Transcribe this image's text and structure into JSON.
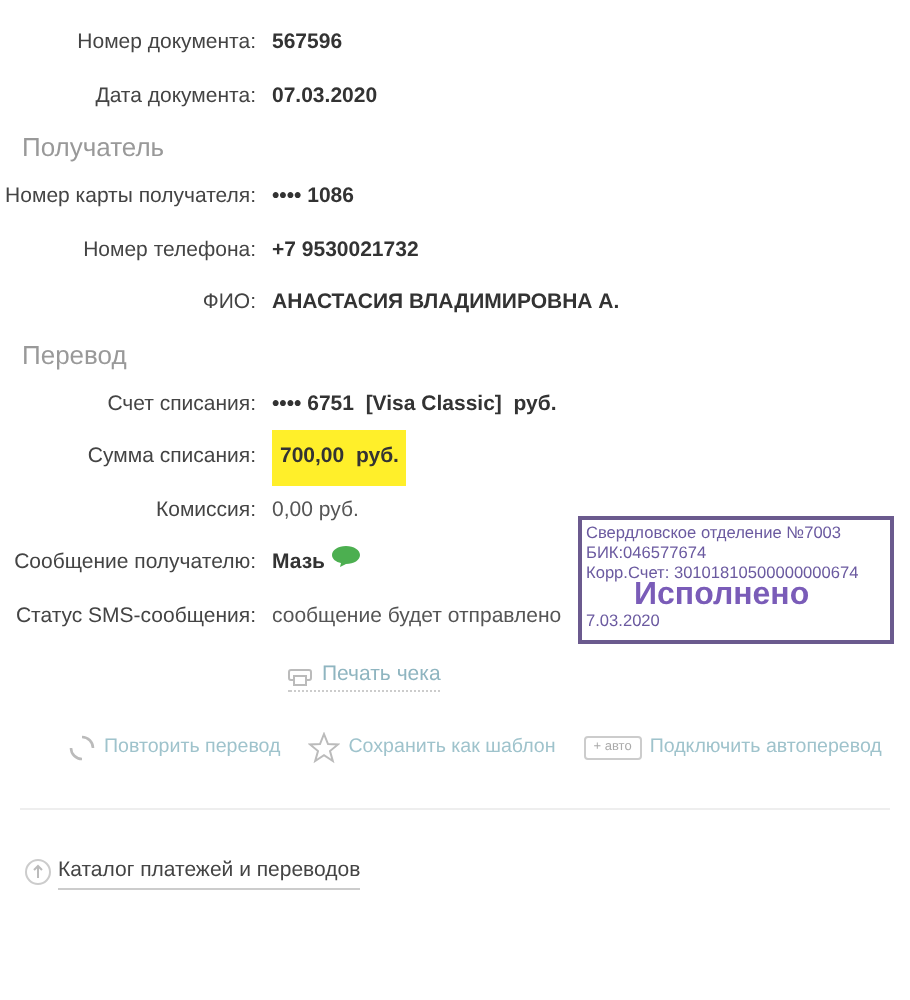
{
  "document": [
    {
      "label": "Номер документа:",
      "value": "567596",
      "kind": "bold"
    },
    {
      "label": "Дата документа:",
      "value": "07.03.2020",
      "kind": "bold"
    }
  ],
  "sections": [
    {
      "title": "Получатель",
      "rows": [
        {
          "label": "Номер карты получателя:",
          "value": "•••• 1086",
          "kind": "bold"
        },
        {
          "label": "Номер телефона:",
          "value": "+7 9530021732",
          "kind": "bold"
        },
        {
          "label": "ФИО:",
          "value": "АНАСТАСИЯ ВЛАДИМИРОВНА А.",
          "kind": "bold"
        }
      ]
    },
    {
      "title": "Перевод",
      "rows": [
        {
          "label": "Счет списания:",
          "value": "•••• 6751  [Visa Classic]  руб.",
          "kind": "bold"
        },
        {
          "label": "Сумма списания:",
          "value": "700,00  руб.",
          "kind": "highlight"
        },
        {
          "label": "Комиссия:",
          "value": "0,00 руб.",
          "kind": "normal"
        },
        {
          "label": "Сообщение получателю:",
          "value": "Мазь",
          "kind": "message"
        },
        {
          "label": "Статус SMS-сообщения:",
          "value": "сообщение будет отправлено",
          "kind": "normal"
        }
      ]
    }
  ],
  "stamp": {
    "lines": [
      "Свердловское отделение №7003",
      "БИК:046577674",
      "Корр.Счет: 30101810500000000674"
    ],
    "status": "Исполнено",
    "date": "7.03.2020"
  },
  "print_link": "Печать чека",
  "actions": [
    {
      "kind": "repeat",
      "label": "Повторить перевод"
    },
    {
      "kind": "template",
      "label": "Сохранить как шаблон"
    },
    {
      "kind": "auto",
      "badge": "+ авто",
      "label": "Подключить автоперевод"
    }
  ],
  "catalog_link": "Каталог платежей и переводов"
}
